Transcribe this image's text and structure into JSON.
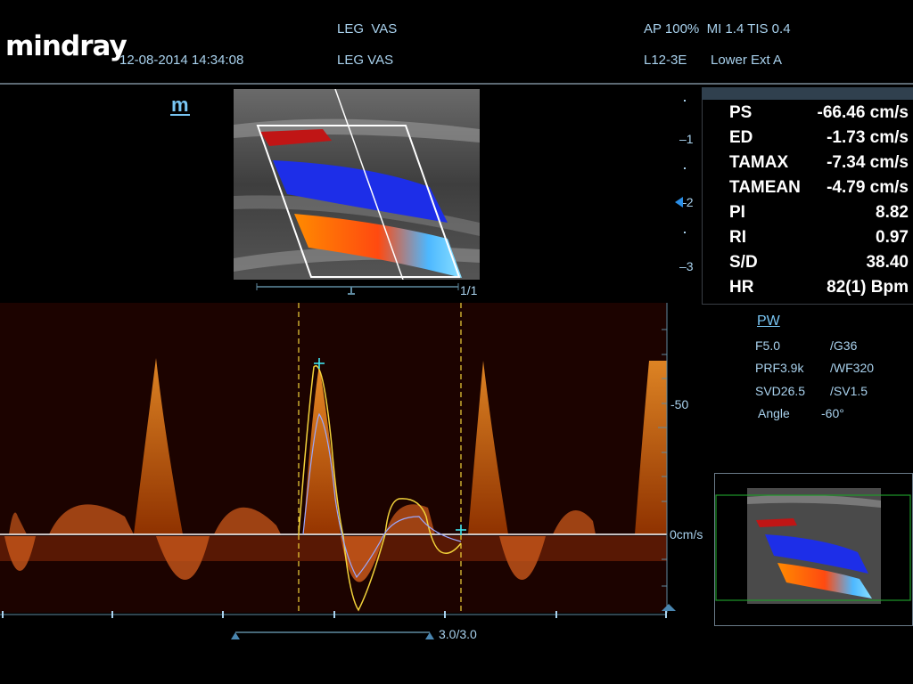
{
  "header": {
    "logo": "mindray",
    "datetime": "12-08-2014 14:34:08",
    "exam_top": "LEG  VAS",
    "exam_bottom": "LEG VAS",
    "power_info": "AP 100%  MI 1.4 TIS 0.4",
    "probe": "L12-3E",
    "preset": "Lower Ext A"
  },
  "mode_icon": "m",
  "bmode": {
    "page_indicator": "1/1",
    "depth_ticks": [
      "1",
      "2",
      "3"
    ]
  },
  "measurements": [
    {
      "label": "PS",
      "value": "-66.46 cm/s"
    },
    {
      "label": "ED",
      "value": "-1.73 cm/s"
    },
    {
      "label": "TAMAX",
      "value": "-7.34 cm/s"
    },
    {
      "label": "TAMEAN",
      "value": "-4.79 cm/s"
    },
    {
      "label": "PI",
      "value": "8.82"
    },
    {
      "label": "RI",
      "value": "0.97"
    },
    {
      "label": "S/D",
      "value": "38.40"
    },
    {
      "label": "HR",
      "value": "82(1) Bpm"
    }
  ],
  "pw_params": {
    "title": "PW",
    "f": "F5.0",
    "g": "/G36",
    "prf": "PRF3.9k",
    "wf": "/WF320",
    "svd": "SVD26.5",
    "sv": "/SV1.5",
    "angle_label": "Angle",
    "angle_value": "-60°"
  },
  "spectrum": {
    "velocity_tick": "-50",
    "baseline_label": "0cm/s",
    "sweep_label": "3.0/3.0"
  },
  "colors": {
    "accent": "#79c6f4",
    "trace": "#f2d23a",
    "caliper": "#3fe3ee"
  }
}
